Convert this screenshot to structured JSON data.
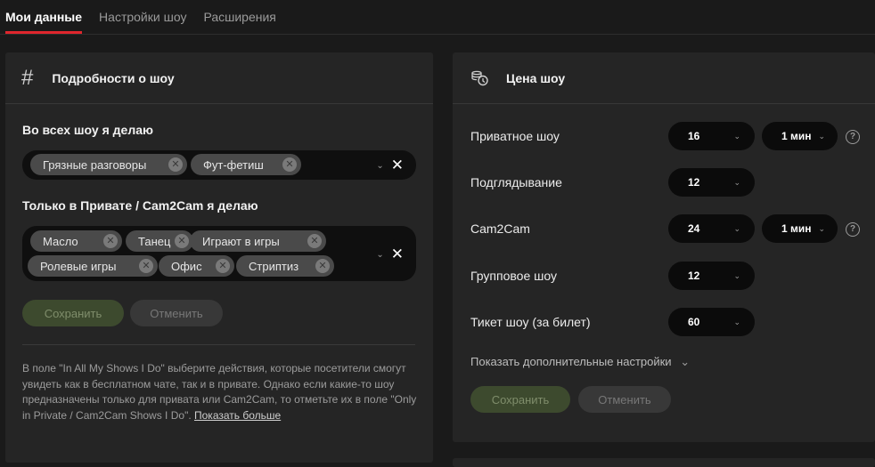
{
  "tabs": [
    "Мои данные",
    "Настройки шоу",
    "Расширения"
  ],
  "details": {
    "title": "Подробности о шоу",
    "all_shows_label": "Во всех шоу я делаю",
    "all_shows_tags": [
      "Грязные разговоры",
      "Фут-фетиш"
    ],
    "private_label": "Только в Привате / Cam2Cam я делаю",
    "private_tags": [
      "Масло",
      "Танец",
      "Играют в игры",
      "Ролевые игры",
      "Офис",
      "Стриптиз"
    ],
    "save_label": "Сохранить",
    "cancel_label": "Отменить",
    "help_text": "В поле \"In All My Shows I Do\" выберите действия, которые посетители смогут увидеть как в бесплатном чате, так и в привате. Однако если какие-то шоу предназначены только для привата или Cam2Cam, то отметьте их в поле \"Only in Private / Cam2Cam Shows I Do\".",
    "help_link": "Показать больше"
  },
  "price": {
    "title": "Цена шоу",
    "rows": [
      {
        "label": "Приватное шоу",
        "value": "16",
        "duration": "1 мин",
        "has_help": true
      },
      {
        "label": "Подглядывание",
        "value": "12"
      },
      {
        "label": "Cam2Cam",
        "value": "24",
        "duration": "1 мин",
        "has_help": true
      },
      {
        "label": "Групповое шоу",
        "value": "12"
      },
      {
        "label": "Тикет шоу (за билет)",
        "value": "60"
      }
    ],
    "more_settings": "Показать дополнительные настройки",
    "save_label": "Сохранить",
    "cancel_label": "Отменить"
  },
  "icons": {
    "details": "hash-icon",
    "price": "coins-icon",
    "remove_tag": "close-circle-icon",
    "dropdown": "chevron-down-icon",
    "clear": "close-icon",
    "help": "question-circle-icon"
  },
  "colors": {
    "accent": "#e0262d",
    "background": "#1a1a1a",
    "panel": "#252525",
    "save_button": "#3d4a2e"
  }
}
